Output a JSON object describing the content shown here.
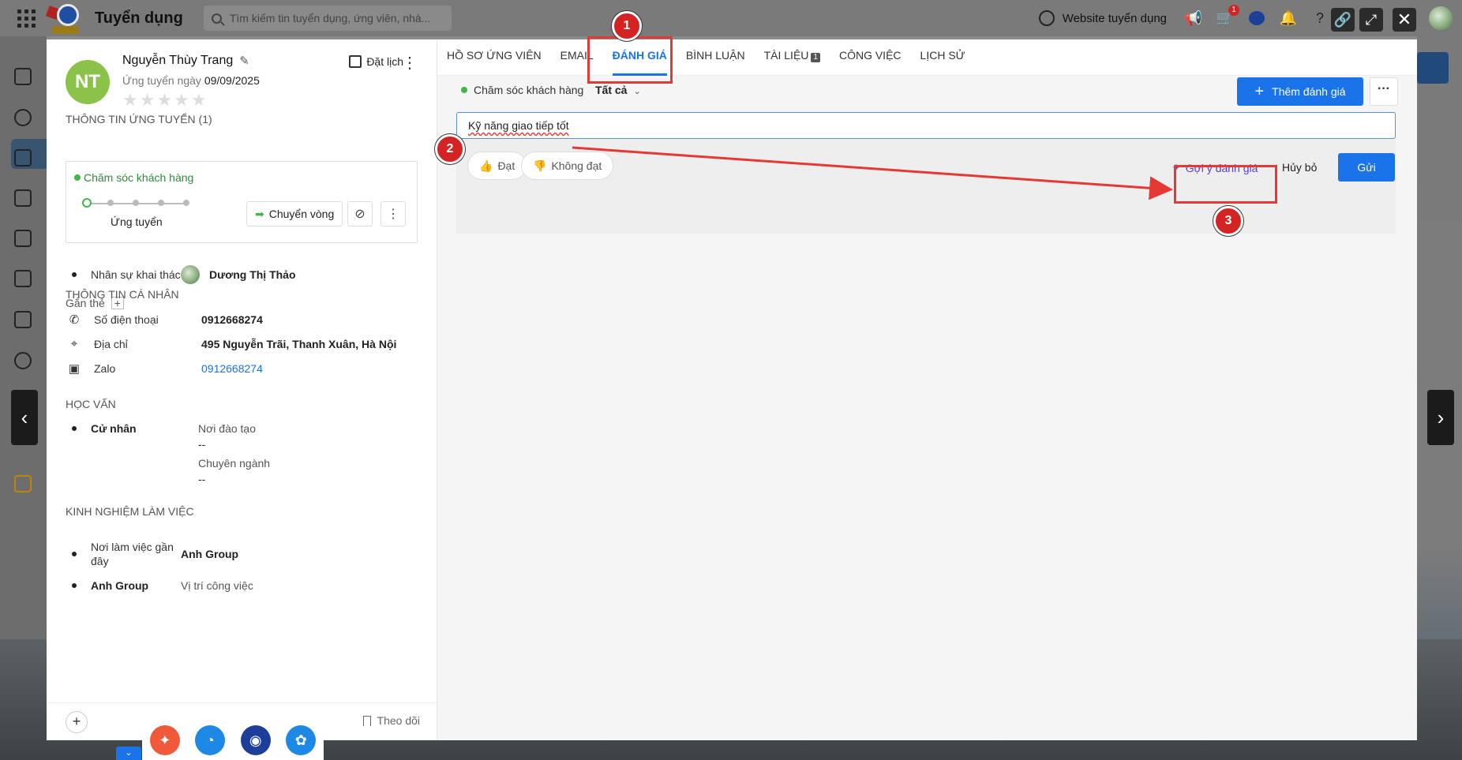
{
  "app": {
    "title": "Tuyển dụng",
    "search_placeholder": "Tìm kiếm tin tuyển dụng, ứng viên, nhà...",
    "website_link": "Website tuyển dụng",
    "notification_count": "1"
  },
  "candidate": {
    "initials": "NT",
    "name": "Nguyễn Thùy Trang",
    "applied_prefix": "Ứng tuyển ngày",
    "applied_date": "09/09/2025",
    "stars": "★★★★★",
    "schedule_label": "Đặt lịch"
  },
  "application": {
    "section_title": "THÔNG TIN ỨNG TUYỂN (1)",
    "pipeline": "Chăm sóc khách hàng",
    "stage": "Ứng tuyển",
    "move_label": "Chuyển vòng",
    "recruiter_label": "Nhân sự khai thác",
    "recruiter_name": "Dương Thị Thảo",
    "tag_label": "Gắn thẻ"
  },
  "personal": {
    "section_title": "THÔNG TIN CÁ NHÂN",
    "phone_label": "Số điện thoại",
    "phone": "0912668274",
    "address_label": "Địa chỉ",
    "address": "495 Nguyễn Trãi, Thanh Xuân, Hà Nội",
    "zalo_label": "Zalo",
    "zalo": "0912668274"
  },
  "education": {
    "section_title": "HỌC VẤN",
    "degree": "Cử nhân",
    "school_label": "Nơi đào tạo",
    "school_value": "--",
    "major_label": "Chuyên ngành",
    "major_value": "--"
  },
  "experience": {
    "section_title": "KINH NGHIỆM LÀM VIỆC",
    "recent_label": "Nơi làm việc gần đây",
    "recent_value": "Anh Group",
    "company": "Anh Group",
    "position_label": "Vị trí công việc"
  },
  "footer": {
    "follow_label": "Theo dõi"
  },
  "tabs": [
    {
      "label": "HỒ SƠ ỨNG VIÊN"
    },
    {
      "label": "EMAIL"
    },
    {
      "label": "ĐÁNH GIÁ"
    },
    {
      "label": "BÌNH LUẬN"
    },
    {
      "label": "TÀI LIỆU",
      "count": "1"
    },
    {
      "label": "CÔNG VIỆC"
    },
    {
      "label": "LỊCH SỬ"
    }
  ],
  "evaluation": {
    "pipeline_filter": "Chăm sóc khách hàng",
    "scope_filter": "Tất cả",
    "add_button": "Thêm đánh giá",
    "input_value": "Kỹ năng giao tiếp tốt",
    "pass_label": "Đạt",
    "fail_label": "Không đạt",
    "suggest_label": "Gợi ý đánh giá",
    "cancel_label": "Hủy bỏ",
    "send_label": "Gửi"
  },
  "annotations": {
    "step1": "1",
    "step2": "2",
    "step3": "3"
  },
  "colors": {
    "accent": "#1a73e8",
    "annotation_red": "#e53935",
    "status_green": "#41b547",
    "suggest_purple": "#5a3fd6"
  }
}
